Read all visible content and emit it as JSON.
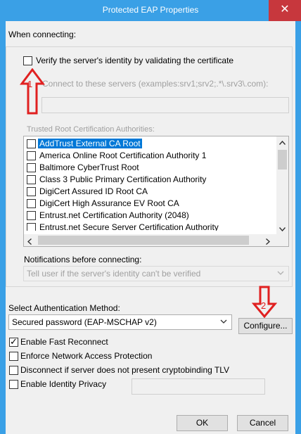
{
  "window": {
    "title": "Protected EAP Properties",
    "close_glyph": "✕"
  },
  "connecting": {
    "group_label": "When connecting:",
    "verify_label": "Verify the server's identity by validating the certificate",
    "verify_checked": false,
    "connect_servers_label": "Connect to these servers (examples:srv1;srv2;.*\\.srv3\\.com):",
    "servers_value": "",
    "trusted_root_label": "Trusted Root Certification Authorities:",
    "cert_list": [
      {
        "name": "AddTrust External CA Root",
        "checked": false,
        "selected": true
      },
      {
        "name": "America Online Root Certification Authority 1",
        "checked": false,
        "selected": false
      },
      {
        "name": "Baltimore CyberTrust Root",
        "checked": false,
        "selected": false
      },
      {
        "name": "Class 3 Public Primary Certification Authority",
        "checked": false,
        "selected": false
      },
      {
        "name": "DigiCert Assured ID Root CA",
        "checked": false,
        "selected": false
      },
      {
        "name": "DigiCert High Assurance EV Root CA",
        "checked": false,
        "selected": false
      },
      {
        "name": "Entrust.net Certification Authority (2048)",
        "checked": false,
        "selected": false
      },
      {
        "name": "Entrust.net Secure Server Certification Authority",
        "checked": false,
        "selected": false
      }
    ],
    "notifications_label": "Notifications before connecting:",
    "notifications_value": "Tell user if the server's identity can't be verified"
  },
  "auth": {
    "method_label": "Select Authentication Method:",
    "method_value": "Secured password (EAP-MSCHAP v2)",
    "configure_label": "Configure..."
  },
  "options": {
    "fast_reconnect": {
      "label": "Enable Fast Reconnect",
      "checked": true
    },
    "nap": {
      "label": "Enforce Network Access Protection",
      "checked": false
    },
    "cryptobinding": {
      "label": "Disconnect if server does not present cryptobinding TLV",
      "checked": false
    },
    "identity_privacy": {
      "label": "Enable Identity Privacy",
      "checked": false,
      "value": ""
    }
  },
  "buttons": {
    "ok": "OK",
    "cancel": "Cancel"
  },
  "annotations": {
    "marker1": "1",
    "marker2": "2",
    "arrow_color": "#e02020"
  },
  "colors": {
    "titlebar": "#3aa0e6",
    "close": "#c7373d",
    "selection": "#0078d7"
  }
}
